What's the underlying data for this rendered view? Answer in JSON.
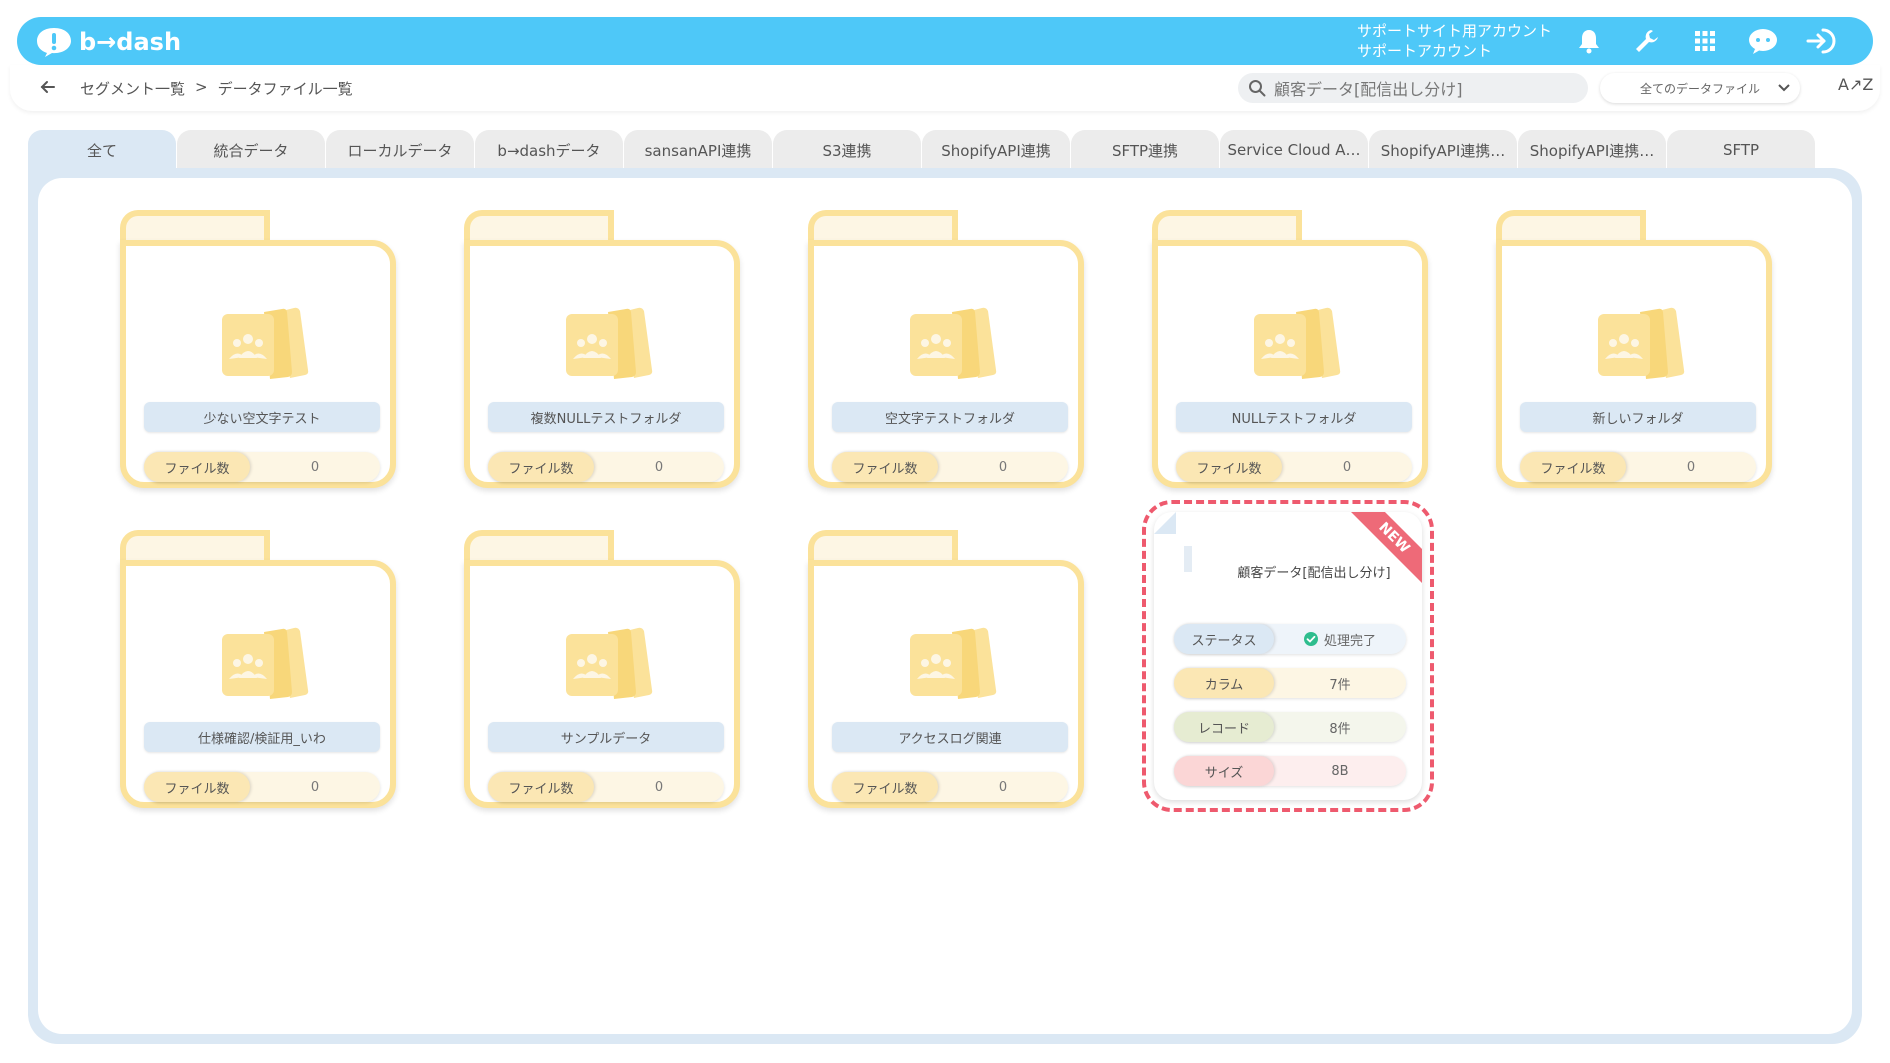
{
  "header": {
    "logo_text": "b→dash",
    "account_line1": "サポートサイト用アカウント",
    "account_line2": "サポートアカウント"
  },
  "breadcrumb": {
    "parent": "セグメント一覧",
    "separator": ">",
    "current": "データファイル一覧"
  },
  "search": {
    "value": "顧客データ[配信出し分け]"
  },
  "filter": {
    "selected": "全てのデータファイル"
  },
  "sort_label": "A↗Z",
  "tabs": [
    {
      "label": "全て"
    },
    {
      "label": "統合データ"
    },
    {
      "label": "ローカルデータ"
    },
    {
      "label": "b→dashデータ"
    },
    {
      "label": "sansanAPI連携"
    },
    {
      "label": "S3連携"
    },
    {
      "label": "ShopifyAPI連携"
    },
    {
      "label": "SFTP連携"
    },
    {
      "label": "Service Cloud A…"
    },
    {
      "label": "ShopifyAPI連携…"
    },
    {
      "label": "ShopifyAPI連携…"
    },
    {
      "label": "SFTP"
    }
  ],
  "folders": [
    {
      "name": "少ない空文字テスト",
      "count_label": "ファイル数",
      "count": "0"
    },
    {
      "name": "複数NULLテストフォルダ",
      "count_label": "ファイル数",
      "count": "0"
    },
    {
      "name": "空文字テストフォルダ",
      "count_label": "ファイル数",
      "count": "0"
    },
    {
      "name": "NULLテストフォルダ",
      "count_label": "ファイル数",
      "count": "0"
    },
    {
      "name": "新しいフォルダ",
      "count_label": "ファイル数",
      "count": "0"
    },
    {
      "name": "仕様確認/検証用_いわ",
      "count_label": "ファイル数",
      "count": "0"
    },
    {
      "name": "サンプルデータ",
      "count_label": "ファイル数",
      "count": "0"
    },
    {
      "name": "アクセスログ関連",
      "count_label": "ファイル数",
      "count": "0"
    }
  ],
  "datafile": {
    "badge": "NEW",
    "title": "顧客データ[配信出し分け]",
    "rows": [
      {
        "label": "ステータス",
        "value": "処理完了"
      },
      {
        "label": "カラム",
        "value": "7件"
      },
      {
        "label": "レコード",
        "value": "8件"
      },
      {
        "label": "サイズ",
        "value": "8B"
      }
    ]
  },
  "colors": {
    "header": "#4ec8f8",
    "folder_border": "#fbe29a",
    "panel": "#dbe8f4",
    "highlight": "#ee5a6e",
    "status_ok": "#2ebd8e"
  }
}
